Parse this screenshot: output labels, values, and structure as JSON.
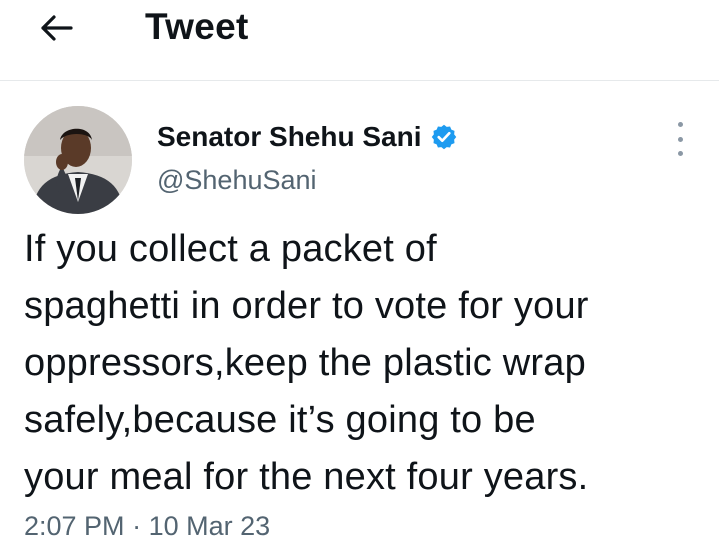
{
  "header": {
    "title": "Tweet",
    "back_icon": "arrow-left-icon"
  },
  "tweet": {
    "author": {
      "display_name": "Senator Shehu Sani",
      "handle": "@ShehuSani",
      "verified": true,
      "verified_icon": "verified-badge-icon",
      "verified_color": "#1d9bf0"
    },
    "more_icon": "vertical-ellipsis-icon",
    "text": "If you collect a packet of\nspaghetti in order to vote for your\noppressors,keep the plastic wrap\nsafely,because it’s going to be\nyour meal for the next four years.",
    "time": "2:07 PM",
    "separator": "·",
    "date": "10 Mar 23"
  },
  "colors": {
    "text": "#0f1419",
    "secondary": "#536471",
    "divider": "#e6e9eb"
  }
}
